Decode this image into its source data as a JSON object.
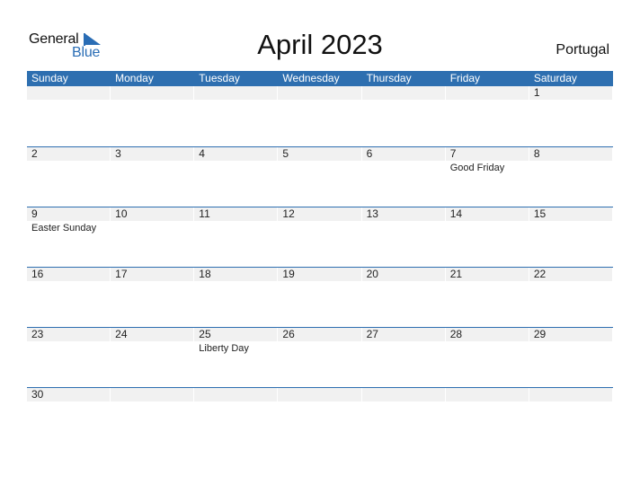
{
  "logo": {
    "general": "General",
    "blue": "Blue"
  },
  "title": "April 2023",
  "country": "Portugal",
  "colors": {
    "accent": "#2e6fb0",
    "day_band": "#f1f1f1"
  },
  "weekdays": [
    "Sunday",
    "Monday",
    "Tuesday",
    "Wednesday",
    "Thursday",
    "Friday",
    "Saturday"
  ],
  "weeks": [
    [
      {
        "day": ""
      },
      {
        "day": ""
      },
      {
        "day": ""
      },
      {
        "day": ""
      },
      {
        "day": ""
      },
      {
        "day": ""
      },
      {
        "day": "1"
      }
    ],
    [
      {
        "day": "2"
      },
      {
        "day": "3"
      },
      {
        "day": "4"
      },
      {
        "day": "5"
      },
      {
        "day": "6"
      },
      {
        "day": "7",
        "event": "Good Friday"
      },
      {
        "day": "8"
      }
    ],
    [
      {
        "day": "9",
        "event": "Easter Sunday"
      },
      {
        "day": "10"
      },
      {
        "day": "11"
      },
      {
        "day": "12"
      },
      {
        "day": "13"
      },
      {
        "day": "14"
      },
      {
        "day": "15"
      }
    ],
    [
      {
        "day": "16"
      },
      {
        "day": "17"
      },
      {
        "day": "18"
      },
      {
        "day": "19"
      },
      {
        "day": "20"
      },
      {
        "day": "21"
      },
      {
        "day": "22"
      }
    ],
    [
      {
        "day": "23"
      },
      {
        "day": "24"
      },
      {
        "day": "25",
        "event": "Liberty Day"
      },
      {
        "day": "26"
      },
      {
        "day": "27"
      },
      {
        "day": "28"
      },
      {
        "day": "29"
      }
    ],
    [
      {
        "day": "30"
      },
      {
        "day": ""
      },
      {
        "day": ""
      },
      {
        "day": ""
      },
      {
        "day": ""
      },
      {
        "day": ""
      },
      {
        "day": ""
      }
    ]
  ]
}
